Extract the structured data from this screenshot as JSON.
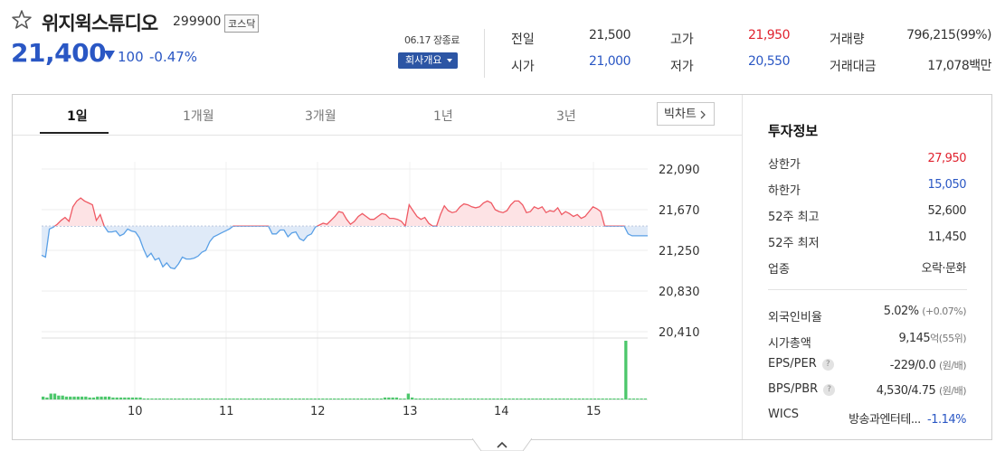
{
  "stock": {
    "name": "위지윅스튜디오",
    "code": "299900",
    "market": "코스닥",
    "price": "21,400",
    "change": "100",
    "change_rate": "-0.47%",
    "close_time": "06.17 장종료",
    "company_button": "회사개요",
    "colors": {
      "down": "#2a57c4",
      "up": "#e0232f"
    }
  },
  "quote": {
    "prev_close": {
      "label": "전일",
      "value": "21,500"
    },
    "open": {
      "label": "시가",
      "value": "21,000"
    },
    "high": {
      "label": "고가",
      "value": "21,950"
    },
    "low": {
      "label": "저가",
      "value": "20,550"
    },
    "volume": {
      "label": "거래량",
      "value": "796,215(99%)"
    },
    "amount": {
      "label": "거래대금",
      "value": "17,078백만"
    }
  },
  "chart_tabs": [
    "1일",
    "1개월",
    "3개월",
    "1년",
    "3년"
  ],
  "bigchart_label": "빅차트",
  "chart_data": {
    "type": "line",
    "y_ticks": [
      "22,090",
      "21,670",
      "21,250",
      "20,830",
      "20,410"
    ],
    "x_ticks": [
      "10",
      "11",
      "12",
      "13",
      "14",
      "15"
    ],
    "reference_price": 21500,
    "ylim": [
      20410,
      22090
    ],
    "grid": true,
    "price_series": [
      21200,
      21180,
      21470,
      21490,
      21520,
      21560,
      21590,
      21550,
      21700,
      21760,
      21790,
      21760,
      21740,
      21720,
      21560,
      21620,
      21500,
      21440,
      21440,
      21450,
      21400,
      21420,
      21470,
      21450,
      21440,
      21380,
      21270,
      21180,
      21220,
      21150,
      21170,
      21080,
      21120,
      21070,
      21060,
      21110,
      21180,
      21160,
      21160,
      21170,
      21190,
      21230,
      21250,
      21340,
      21390,
      21410,
      21430,
      21450,
      21470,
      21500,
      21500,
      21500,
      21500,
      21500,
      21500,
      21500,
      21500,
      21500,
      21500,
      21420,
      21420,
      21460,
      21460,
      21390,
      21430,
      21440,
      21370,
      21350,
      21400,
      21420,
      21490,
      21510,
      21530,
      21520,
      21560,
      21600,
      21650,
      21640,
      21570,
      21520,
      21550,
      21600,
      21630,
      21600,
      21570,
      21570,
      21600,
      21630,
      21620,
      21580,
      21580,
      21570,
      21550,
      21500,
      21720,
      21660,
      21600,
      21570,
      21590,
      21530,
      21500,
      21500,
      21620,
      21710,
      21660,
      21640,
      21650,
      21700,
      21730,
      21720,
      21700,
      21690,
      21700,
      21740,
      21760,
      21740,
      21670,
      21650,
      21640,
      21660,
      21720,
      21760,
      21760,
      21720,
      21640,
      21650,
      21700,
      21680,
      21700,
      21640,
      21660,
      21650,
      21690,
      21620,
      21650,
      21630,
      21600,
      21620,
      21580,
      21600,
      21650,
      21700,
      21680,
      21650,
      21500,
      21500,
      21500,
      21500,
      21500,
      21500,
      21420,
      21400,
      21400,
      21400,
      21400,
      21400
    ],
    "volume_series": [
      3,
      2,
      6,
      6,
      4,
      4,
      3,
      3,
      3,
      3,
      3,
      3,
      2,
      2,
      3,
      3,
      3,
      3,
      2,
      2,
      2,
      2,
      2,
      2,
      2,
      2,
      1,
      1,
      1,
      1,
      1,
      1,
      1,
      1,
      1,
      1,
      1,
      1,
      1,
      1,
      1,
      1,
      1,
      1,
      1,
      1,
      1,
      1,
      1,
      1,
      1,
      1,
      1,
      1,
      1,
      1,
      1,
      1,
      1,
      1,
      1,
      1,
      1,
      1,
      1,
      1,
      1,
      1,
      1,
      1,
      1,
      1,
      1,
      1,
      1,
      1,
      1,
      1,
      1,
      1,
      1,
      1,
      1,
      1,
      1,
      1,
      1,
      1,
      2,
      2,
      2,
      2,
      1,
      1,
      6,
      2,
      1,
      1,
      1,
      1,
      1,
      1,
      1,
      1,
      1,
      1,
      1,
      1,
      1,
      1,
      1,
      1,
      1,
      1,
      1,
      1,
      1,
      1,
      1,
      1,
      1,
      1,
      1,
      1,
      1,
      1,
      1,
      1,
      1,
      1,
      1,
      1,
      1,
      1,
      1,
      1,
      1,
      1,
      1,
      1,
      1,
      1,
      1,
      1,
      1,
      1,
      1,
      1,
      1,
      1,
      60,
      1,
      1,
      1,
      1,
      1
    ]
  },
  "invest": {
    "title": "투자정보",
    "upper_limit": {
      "label": "상한가",
      "value": "27,950"
    },
    "lower_limit": {
      "label": "하한가",
      "value": "15,050"
    },
    "high52": {
      "label": "52주 최고",
      "value": "52,600"
    },
    "low52": {
      "label": "52주 최저",
      "value": "11,450"
    },
    "sector": {
      "label": "업종",
      "value": "오락·문화"
    },
    "foreign": {
      "label": "외국인비율",
      "value": "5.02%",
      "sub": "(+0.07%)"
    },
    "mcap": {
      "label": "시가총액",
      "value": "9,145",
      "unit": "억",
      "sub": "(55위)"
    },
    "eps": {
      "label": "EPS/PER",
      "value": "-229/0.0",
      "sub": "(원/배)"
    },
    "bps": {
      "label": "BPS/PBR",
      "value": "4,530/4.75",
      "sub": "(원/배)"
    },
    "wics": {
      "label": "WICS",
      "value": "방송과엔터테...",
      "rate": "-1.14%"
    },
    "help_glyph": "?"
  }
}
